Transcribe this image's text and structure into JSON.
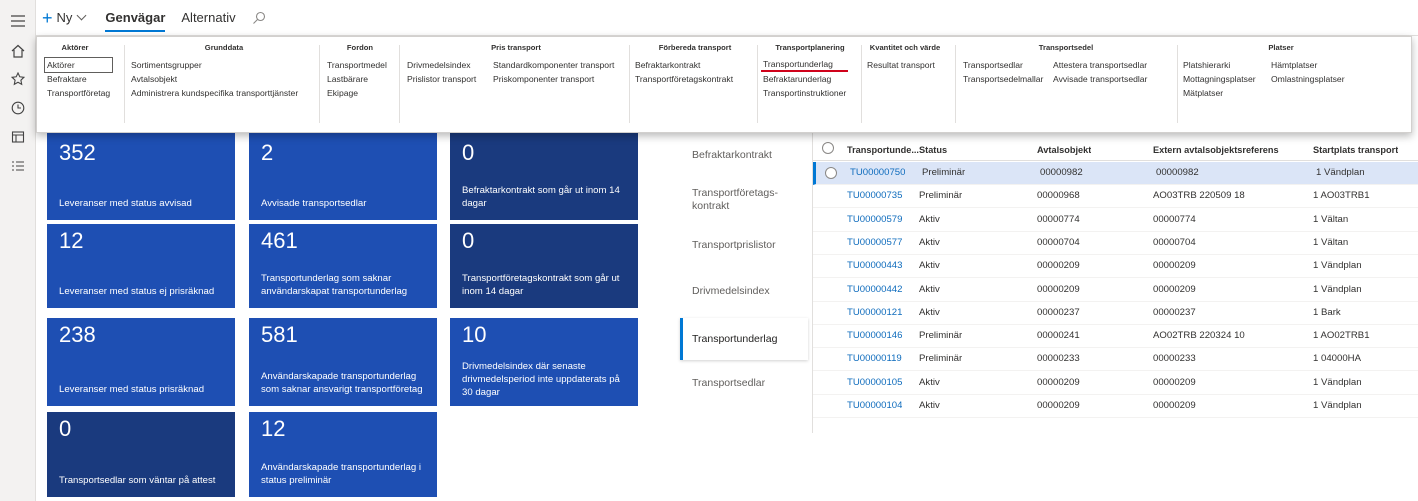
{
  "rail": {
    "icons": [
      "hamburger-icon",
      "home-icon",
      "star-icon",
      "clock-icon",
      "workspace-icon",
      "list-icon"
    ]
  },
  "cmdbar": {
    "new_label": "Ny",
    "tabs": [
      {
        "label": "Genvägar",
        "active": true
      },
      {
        "label": "Alternativ",
        "active": false
      }
    ],
    "search_icon": "search-icon"
  },
  "ribbon": {
    "groups": [
      {
        "title": "Aktörer",
        "columns": [
          [
            "Aktörer",
            "Befraktare",
            "Transportföretag"
          ]
        ],
        "selected": "Aktörer"
      },
      {
        "title": "Grunddata",
        "columns": [
          [
            "Sortimentsgrupper",
            "Avtalsobjekt",
            "Administrera kundspecifika transporttjänster"
          ]
        ]
      },
      {
        "title": "Fordon",
        "columns": [
          [
            "Transportmedel",
            "Lastbärare",
            "Ekipage"
          ]
        ]
      },
      {
        "title": "Pris transport",
        "columns": [
          [
            "Drivmedelsindex",
            "Prislistor transport"
          ],
          [
            "Standardkomponenter transport",
            "Priskomponenter transport"
          ]
        ]
      },
      {
        "title": "Förbereda transport",
        "columns": [
          [
            "Befraktarkontrakt",
            "Transportföretagskontrakt"
          ]
        ]
      },
      {
        "title": "Transportplanering",
        "columns": [
          [
            "Transportunderlag",
            "Befraktarunderlag",
            "Transportinstruktioner"
          ]
        ],
        "highlighted": "Transportunderlag"
      },
      {
        "title": "Kvantitet och värde",
        "columns": [
          [
            "Resultat transport"
          ]
        ]
      },
      {
        "title": "Transportsedel",
        "columns": [
          [
            "Transportsedlar",
            "Transportsedelmallar"
          ],
          [
            "Attestera transportsedlar",
            "Avvisade transportsedlar"
          ]
        ]
      },
      {
        "title": "Platser",
        "columns": [
          [
            "Platshierarki",
            "Mottagningsplatser",
            "Mätplatser"
          ],
          [
            "Hämtplatser",
            "Omlastningsplatser"
          ]
        ]
      }
    ]
  },
  "tiles": [
    {
      "value": "352",
      "label": "Leveranser med status avvisad"
    },
    {
      "value": "2",
      "label": "Avvisade transportsedlar"
    },
    {
      "value": "0",
      "label": "Befraktarkontrakt som går ut inom 14 dagar"
    },
    {
      "value": "12",
      "label": "Leveranser med status ej prisräknad"
    },
    {
      "value": "461",
      "label": "Transportunderlag som saknar användarskapat transportunderlag"
    },
    {
      "value": "0",
      "label": "Transportföretagskontrakt som går ut inom 14 dagar"
    },
    {
      "value": "238",
      "label": "Leveranser med status prisräknad"
    },
    {
      "value": "581",
      "label": "Användarskapade transportunderlag som saknar ansvarigt transportföretag"
    },
    {
      "value": "10",
      "label": "Drivmedelsindex där senaste drivmedelsperiod inte uppdaterats på 30 dagar"
    },
    {
      "value": "0",
      "label": "Transportsedlar som väntar på attest"
    },
    {
      "value": "12",
      "label": "Användarskapade transportunderlag i status preliminär"
    }
  ],
  "midnav": {
    "items": [
      "Befraktarkontrakt",
      "Transportföretags-kontrakt",
      "Transportprislistor",
      "Drivmedelsindex",
      "Transportunderlag",
      "Transportsedlar"
    ],
    "selected": "Transportunderlag"
  },
  "grid": {
    "columns": [
      "Transportunde...",
      "Status",
      "Avtalsobjekt",
      "Extern avtalsobjektsreferens",
      "Startplats transport"
    ],
    "rows": [
      [
        "TU00000750",
        "Preliminär",
        "00000982",
        "00000982",
        "1 Vändplan"
      ],
      [
        "TU00000735",
        "Preliminär",
        "00000968",
        "AO03TRB 220509 18",
        "1 AO03TRB1"
      ],
      [
        "TU00000579",
        "Aktiv",
        "00000774",
        "00000774",
        "1 Vältan"
      ],
      [
        "TU00000577",
        "Aktiv",
        "00000704",
        "00000704",
        "1 Vältan"
      ],
      [
        "TU00000443",
        "Aktiv",
        "00000209",
        "00000209",
        "1 Vändplan"
      ],
      [
        "TU00000442",
        "Aktiv",
        "00000209",
        "00000209",
        "1 Vändplan"
      ],
      [
        "TU00000121",
        "Aktiv",
        "00000237",
        "00000237",
        "1 Bark"
      ],
      [
        "TU00000146",
        "Preliminär",
        "00000241",
        "AO02TRB 220324 10",
        "1 AO02TRB1"
      ],
      [
        "TU00000119",
        "Preliminär",
        "00000233",
        "00000233",
        "1 04000HA"
      ],
      [
        "TU00000105",
        "Aktiv",
        "00000209",
        "00000209",
        "1 Vändplan"
      ],
      [
        "TU00000104",
        "Aktiv",
        "00000209",
        "00000209",
        "1 Vändplan"
      ]
    ],
    "selected_row": 0
  },
  "colors": {
    "tile": "#1e4fb3",
    "tile_dark": "#1a3a7e",
    "accent": "#0078d4",
    "link": "#0f6cbd",
    "highlight_underline": "#d0021b"
  }
}
